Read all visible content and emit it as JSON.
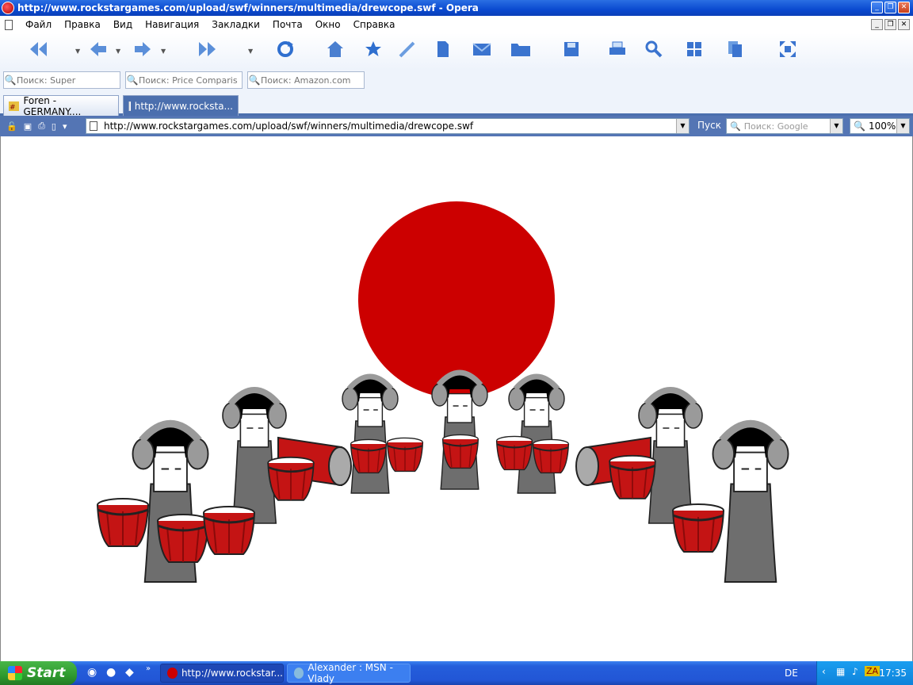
{
  "window": {
    "title": "http://www.rockstargames.com/upload/swf/winners/multimedia/drewcope.swf - Opera",
    "buttons": [
      "_",
      "❐",
      "✕"
    ]
  },
  "menu": {
    "items": [
      "Файл",
      "Правка",
      "Вид",
      "Навигация",
      "Закладки",
      "Почта",
      "Окно",
      "Справка"
    ],
    "mdi_buttons": [
      "_",
      "❐",
      "✕"
    ]
  },
  "toolbar": {
    "icons": [
      "rewind-icon",
      "back-icon",
      "forward-icon",
      "fast-forward-icon",
      "reload-icon",
      "home-icon",
      "bookmark-star-icon",
      "pen-icon",
      "page-icon",
      "mail-icon",
      "folder-icon",
      "save-icon",
      "print-icon",
      "search-icon",
      "windows-icon",
      "copy-icon",
      "fullscreen-icon"
    ]
  },
  "search_fields": [
    {
      "placeholder": "Поиск: Super"
    },
    {
      "placeholder": "Поиск: Price Comparis"
    },
    {
      "placeholder": "Поиск: Amazon.com"
    }
  ],
  "tabs": [
    {
      "label": "Foren - GERMANY....",
      "active": false
    },
    {
      "label": "http://www.rocksta...",
      "active": true
    }
  ],
  "address": {
    "url": "http://www.rockstargames.com/upload/swf/winners/multimedia/drewcope.swf",
    "go_label": "Пуск",
    "search_placeholder": "Поиск: Google",
    "zoom": "100%"
  },
  "taskbar": {
    "start_label": "Start",
    "tasks": [
      {
        "label": "http://www.rockstar...",
        "active": true
      },
      {
        "label": "Alexander : MSN - Vlady",
        "active": false
      }
    ],
    "language": "DE",
    "clock": "17:35",
    "colors": {
      "sun": "#cc0000",
      "drum": "#c41414"
    }
  }
}
